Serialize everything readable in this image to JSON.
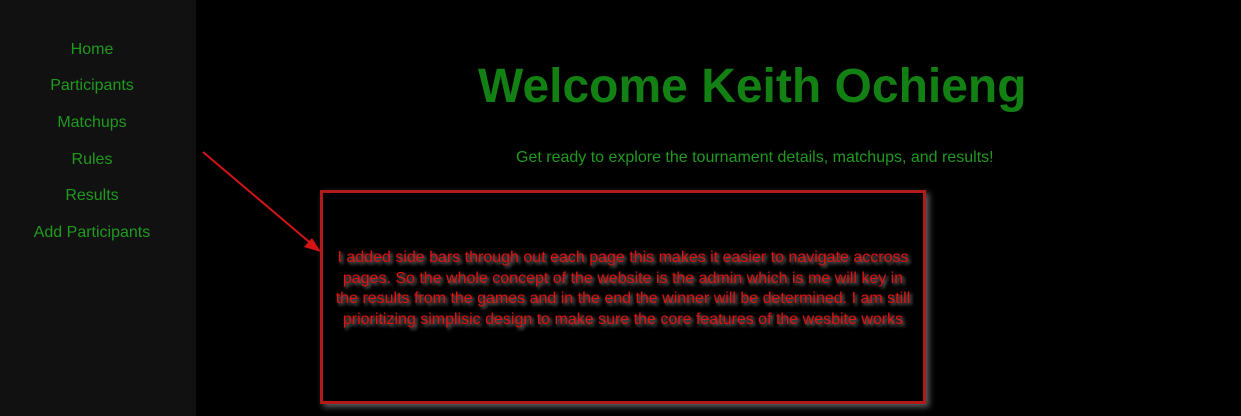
{
  "sidebar": {
    "items": [
      {
        "label": "Home"
      },
      {
        "label": "Participants"
      },
      {
        "label": "Matchups"
      },
      {
        "label": "Rules"
      },
      {
        "label": "Results"
      },
      {
        "label": "Add Participants"
      }
    ]
  },
  "main": {
    "title": "Welcome Keith Ochieng",
    "subtitle": "Get ready to explore the tournament details, matchups, and results!"
  },
  "annotation": {
    "text": "I added side bars through out each page this makes it easier to navigate accross pages. So the whole concept of the website is the admin which is me will key in the results from the games and in the end the winner will be determined. I am still prioritizing simplisic design to make sure the core features of the wesbite works",
    "color": "#e31212",
    "border_color": "#b01a1a"
  },
  "colors": {
    "background": "#000000",
    "sidebar_bg": "#111111",
    "nav_text": "#1f9a1f",
    "title": "#138013"
  }
}
